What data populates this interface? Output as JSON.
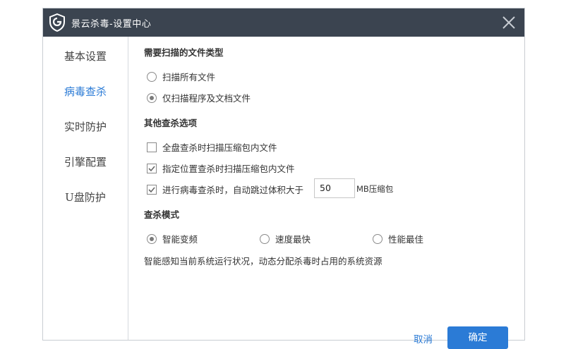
{
  "window": {
    "title": "景云杀毒-设置中心"
  },
  "sidebar": {
    "items": [
      {
        "label": "基本设置",
        "active": false
      },
      {
        "label": "病毒查杀",
        "active": true
      },
      {
        "label": "实时防护",
        "active": false
      },
      {
        "label": "引擎配置",
        "active": false
      },
      {
        "label": "U盘防护",
        "active": false
      }
    ]
  },
  "scan_types": {
    "heading": "需要扫描的文件类型",
    "options": [
      {
        "label": "扫描所有文件",
        "selected": false
      },
      {
        "label": "仅扫描程序及文档文件",
        "selected": true
      }
    ]
  },
  "other_options": {
    "heading": "其他查杀选项",
    "items": [
      {
        "label": "全盘查杀时扫描压缩包内文件",
        "checked": false
      },
      {
        "label": "指定位置查杀时扫描压缩包内文件",
        "checked": true
      },
      {
        "label": "进行病毒查杀时，自动跳过体积大于",
        "checked": true
      }
    ],
    "size_value": "50",
    "size_unit": "MB压缩包"
  },
  "scan_mode": {
    "heading": "查杀模式",
    "options": [
      {
        "label": "智能变频",
        "selected": true
      },
      {
        "label": "速度最快",
        "selected": false
      },
      {
        "label": "性能最佳",
        "selected": false
      }
    ],
    "description": "智能感知当前系统运行状况，动态分配杀毒时占用的系统资源"
  },
  "footer": {
    "cancel_label": "取消",
    "ok_label": "确定"
  },
  "colors": {
    "titlebar": "#3b4450",
    "accent": "#2b7bd6"
  }
}
